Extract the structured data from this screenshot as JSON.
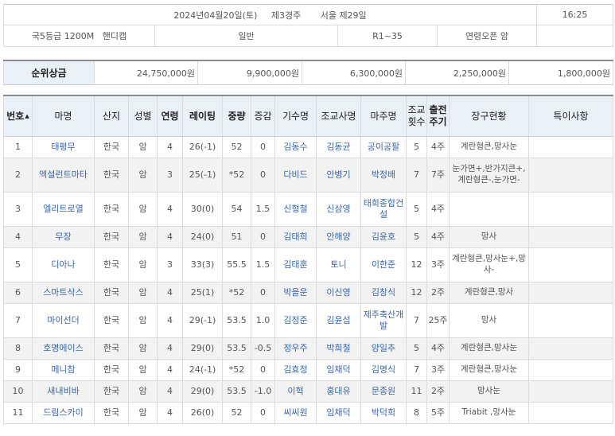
{
  "race_info": {
    "date": "2024년04월20일(토)",
    "race_no": "제3경주",
    "track": "서울 제29일",
    "start_time": "16:25",
    "grade": "국5등급",
    "distance": "1200M",
    "race_type": "핸디캡",
    "class": "일반",
    "rating": "R1~35",
    "condition": "연령오픈 암"
  },
  "prize": {
    "label": "순위상금",
    "values": [
      "24,750,000원",
      "9,900,000원",
      "6,300,000원",
      "2,250,000원",
      "1,800,000원"
    ]
  },
  "columns": {
    "no": "번호",
    "horse": "마명",
    "origin": "산지",
    "sex": "성별",
    "age": "연령",
    "rating": "레이팅",
    "weight": "중량",
    "change": "증감",
    "jockey": "기수명",
    "trainer": "조교사명",
    "owner": "마주명",
    "train_count_1": "조교",
    "train_count_2": "횟수",
    "cycle_1": "출전",
    "cycle_2": "주기",
    "gear": "장구현황",
    "notes": "특이사항",
    "sort_symbol": "▲"
  },
  "horses": [
    {
      "no": "1",
      "name": "태평무",
      "origin": "한국",
      "sex": "암",
      "age": "4",
      "rating": "26(-1)",
      "weight": "52",
      "change": "0",
      "jockey": "김동수",
      "trainer": "김동균",
      "owner": "공이공팔",
      "train": "5",
      "cycle": "4주",
      "gear": "계란형큰,망사눈",
      "notes": ""
    },
    {
      "no": "2",
      "name": "엑설런트마타",
      "origin": "한국",
      "sex": "암",
      "age": "3",
      "rating": "25(-1)",
      "weight": "*52",
      "change": "0",
      "jockey": "다비드",
      "trainer": "안병기",
      "owner": "박정배",
      "train": "7",
      "cycle": "7주",
      "gear": "눈가면+,반가지큰+,계란형큰-,눈가면-",
      "notes": ""
    },
    {
      "no": "3",
      "name": "엘리트로열",
      "origin": "한국",
      "sex": "암",
      "age": "4",
      "rating": "30(0)",
      "weight": "54",
      "change": "1.5",
      "jockey": "신형철",
      "trainer": "신삼영",
      "owner": "태희종합건설",
      "train": "5",
      "cycle": "4주",
      "gear": "",
      "notes": ""
    },
    {
      "no": "4",
      "name": "무장",
      "origin": "한국",
      "sex": "암",
      "age": "4",
      "rating": "24(0)",
      "weight": "51",
      "change": "0",
      "jockey": "김태희",
      "trainer": "안해양",
      "owner": "김윤호",
      "train": "5",
      "cycle": "4주",
      "gear": "망사",
      "notes": ""
    },
    {
      "no": "5",
      "name": "디아나",
      "origin": "한국",
      "sex": "암",
      "age": "3",
      "rating": "33(3)",
      "weight": "55.5",
      "change": "1.5",
      "jockey": "김태훈",
      "trainer": "토니",
      "owner": "이한준",
      "train": "12",
      "cycle": "3주",
      "gear": "계란형큰,망사눈+,망사-",
      "notes": ""
    },
    {
      "no": "6",
      "name": "스마트삭스",
      "origin": "한국",
      "sex": "암",
      "age": "4",
      "rating": "25(1)",
      "weight": "*52",
      "change": "0",
      "jockey": "박을운",
      "trainer": "이신영",
      "owner": "김창식",
      "train": "12",
      "cycle": "2주",
      "gear": "계란형큰,망사",
      "notes": ""
    },
    {
      "no": "7",
      "name": "마이선더",
      "origin": "한국",
      "sex": "암",
      "age": "4",
      "rating": "29(-1)",
      "weight": "53.5",
      "change": "1.0",
      "jockey": "김정준",
      "trainer": "김윤섭",
      "owner": "제주축산개발",
      "train": "7",
      "cycle": "25주",
      "gear": "망사",
      "notes": ""
    },
    {
      "no": "8",
      "name": "호명에이스",
      "origin": "한국",
      "sex": "암",
      "age": "4",
      "rating": "29(0)",
      "weight": "53.5",
      "change": "-0.5",
      "jockey": "정우주",
      "trainer": "박희철",
      "owner": "양일추",
      "train": "5",
      "cycle": "4주",
      "gear": "계란형큰,망사눈",
      "notes": ""
    },
    {
      "no": "9",
      "name": "메니참",
      "origin": "한국",
      "sex": "암",
      "age": "4",
      "rating": "24(-1)",
      "weight": "*52",
      "change": "0",
      "jockey": "김효정",
      "trainer": "임채덕",
      "owner": "김명식",
      "train": "7",
      "cycle": "3주",
      "gear": "계란형큰,망사눈",
      "notes": ""
    },
    {
      "no": "10",
      "name": "새내비바",
      "origin": "한국",
      "sex": "암",
      "age": "4",
      "rating": "29(0)",
      "weight": "53.5",
      "change": "-1.0",
      "jockey": "이혁",
      "trainer": "홍대유",
      "owner": "문종원",
      "train": "11",
      "cycle": "2주",
      "gear": "망사눈",
      "notes": ""
    },
    {
      "no": "11",
      "name": "드림스카이",
      "origin": "한국",
      "sex": "암",
      "age": "4",
      "rating": "26(0)",
      "weight": "52",
      "change": "0",
      "jockey": "씨씨원",
      "trainer": "임채덕",
      "owner": "박덕희",
      "train": "8",
      "cycle": "5주",
      "gear": "Triabit ,망사눈",
      "notes": ""
    }
  ]
}
